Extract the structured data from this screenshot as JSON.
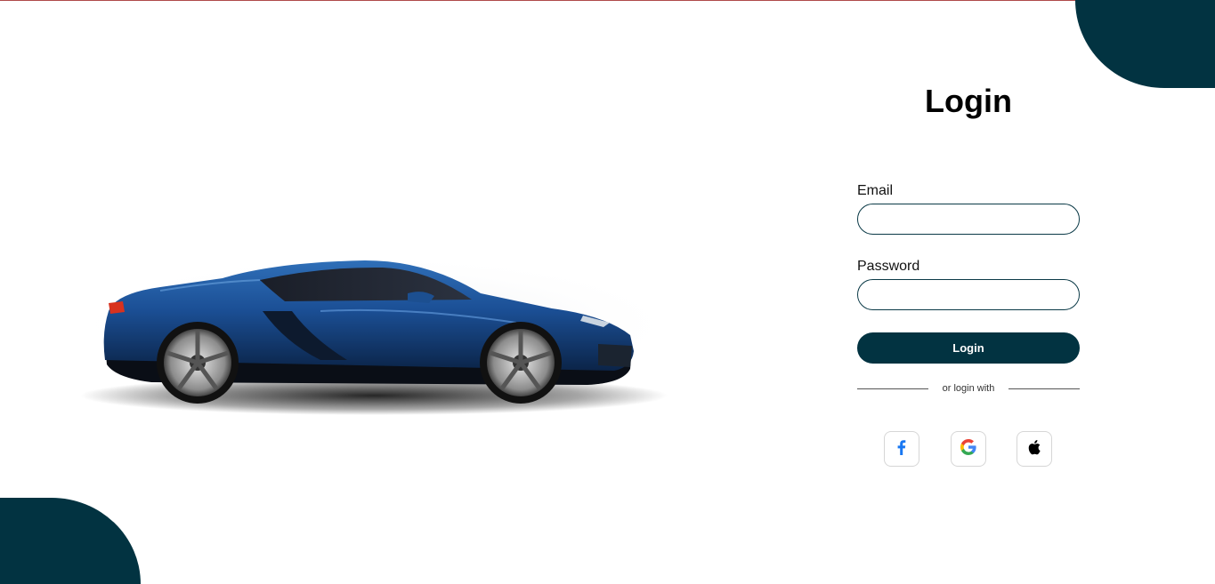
{
  "brand": {
    "accent": "#023341",
    "top_line": "#b04a4a"
  },
  "hero": {
    "image_name": "blue-sports-car"
  },
  "login": {
    "title": "Login",
    "email_label": "Email",
    "email_value": "",
    "password_label": "Password",
    "password_value": "",
    "submit_label": "Login",
    "divider_text": "or login with",
    "social": [
      {
        "icon": "facebook-icon"
      },
      {
        "icon": "google-icon"
      },
      {
        "icon": "apple-icon"
      }
    ]
  }
}
